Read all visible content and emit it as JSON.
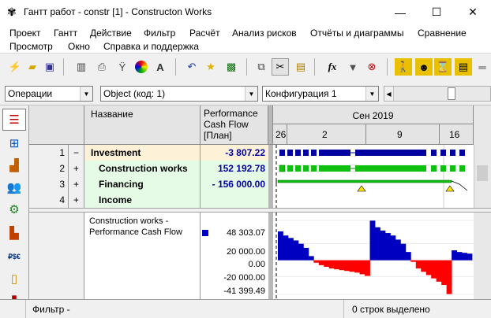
{
  "window": {
    "title": "Гантт работ - constr [1] - Constructon Works",
    "minimize": "—",
    "maximize": "☐",
    "close": "✕"
  },
  "menu": [
    "Проект",
    "Гантт",
    "Действие",
    "Фильтр",
    "Расчёт",
    "Анализ рисков",
    "Отчёты и диаграммы",
    "Сравнение",
    "Просмотр",
    "Окно",
    "Справка и поддержка"
  ],
  "selectors": {
    "view": "Операции",
    "object": "Object (код: 1)",
    "config": "Конфигурация 1"
  },
  "table": {
    "headers": {
      "name": "Название",
      "perf": "Performance Cash Flow",
      "perf_unit": "[План]",
      "month": "Сен 2019"
    },
    "days": [
      "26",
      "2",
      "9",
      "16"
    ],
    "rows": [
      {
        "num": "1",
        "expand": "−",
        "name": "Investment",
        "value": "-3 807.22"
      },
      {
        "num": "2",
        "expand": "+",
        "name": "Construction works",
        "value": "152 192.78"
      },
      {
        "num": "3",
        "expand": "+",
        "name": "Financing",
        "value": "- 156 000.00"
      },
      {
        "num": "4",
        "expand": "+",
        "name": "Income",
        "value": ""
      }
    ]
  },
  "chart": {
    "label": "Construction works - Performance Cash Flow",
    "axis_values": [
      "48 303.07",
      "20 000.00",
      "0.00",
      "-20 000.00",
      "-41 399.49"
    ],
    "colors": {
      "positive": "#0000c0",
      "negative": "#ff0000"
    }
  },
  "chart_data": {
    "type": "area",
    "ylim": [
      -41399.49,
      48303.07
    ],
    "ticks": [
      48303.07,
      20000,
      0,
      -20000,
      -41399.49
    ],
    "series": [
      {
        "values": [
          35000,
          30000,
          27000,
          24000,
          20000,
          15000,
          5000,
          -3000,
          -6000,
          -8000,
          -10000,
          -11000,
          -12000,
          -13000,
          -14000,
          -15000,
          -17000,
          -19000,
          48000,
          40000,
          36000,
          33000,
          30000,
          25000,
          20000,
          10000,
          -2000,
          -10000,
          -14000,
          -18000,
          -22000,
          -26000,
          -30000,
          -41000,
          12000,
          10000,
          9000,
          8000
        ]
      }
    ]
  },
  "status": {
    "filter": "Фильтр -",
    "selected": "0 строк выделено"
  }
}
